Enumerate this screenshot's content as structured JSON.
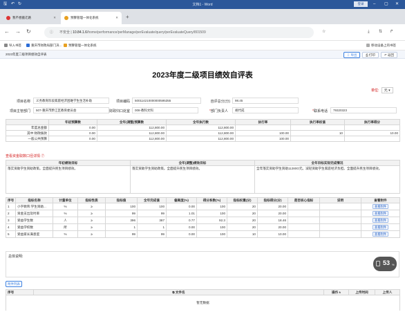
{
  "word": {
    "title": "文档1 - Word",
    "login": "登录"
  },
  "tabs": [
    {
      "label": "我不想搬迁路"
    },
    {
      "label": "预算管理一体化系统"
    }
  ],
  "address": {
    "secure": "不安全",
    "host": "10.84.1.6",
    "path": "/home/performance/perManage/perEvaluate/query/perEvaluateQuery/801509"
  },
  "bookmarks": {
    "import": "导入书签",
    "b1": "重庆市财政局部门决...",
    "b2": "预算管理一体化系统",
    "mobile": "移动设备上的书签"
  },
  "breadcrumb": "2023年度二级项目绩效自评表",
  "toolbar": {
    "export": "导出",
    "print": "打印",
    "back": "返回"
  },
  "doc": {
    "title": "2023年度二级项目绩效自评表",
    "unit_label": "单位:",
    "unit_value": "元"
  },
  "info": {
    "proj_name_label": "项目名称",
    "proj_name": "义务教育阶段家庭经济困难学生生活补助",
    "proj_code_label": "项目编码",
    "proj_code": "500114210000000595355",
    "score_label": "自评总分(分)",
    "score": "98.45",
    "dept_label": "项目主管部门",
    "dept": "507-重庆市黔江区教育委员会",
    "office_label": "财政归口处室",
    "office": "008-教科文科",
    "leader_label": "部门负责人",
    "leader": "胡代成",
    "phone_label": "联系电话",
    "phone": "79320323"
  },
  "funds": {
    "headers": [
      "",
      "年初预算数",
      "全年(调整)预算数",
      "全年执行数",
      "执行率",
      "执行率权值",
      "执行率得分"
    ],
    "rows": [
      [
        "年度总金额",
        "0.00",
        "112,800.00",
        "112,800.00",
        "",
        "",
        ""
      ],
      [
        "其中:财政拨款",
        "0.00",
        "112,800.00",
        "112,800.00",
        "100.00",
        "10",
        "10.00"
      ],
      [
        "一般公共预算",
        "0.00",
        "112,800.00",
        "112,800.00",
        "100.00",
        "",
        ""
      ]
    ]
  },
  "detail_link": "查看资金取数口径详情 ⑦",
  "goals": {
    "headers": [
      "年初绩效目标",
      "全年(调整)绩效目标",
      "全年目标实际完成情况"
    ],
    "row": [
      "落实资助学生资助政策。全面提升民生项目绩效。",
      "落实资助学生资助政策。全面提升民生项目绩效。",
      "全年落实资助学生资助11280O元。减轻资助学生家庭经济负担。全面提升民生项目绩效。"
    ]
  },
  "indicators": {
    "headers": [
      "序号",
      "指标名称",
      "计量单位",
      "指标性质",
      "指标值",
      "全年完成值",
      "偏离度(%)",
      "得分系数(%)",
      "指标权重(分)",
      "指标得分(分)",
      "是否核心指标",
      "说明",
      "查看附件"
    ],
    "rows": [
      [
        "1",
        "小学教育:学生资助...",
        "%",
        "≥",
        "100",
        "100",
        "0.00",
        "100",
        "20",
        "20.00",
        "",
        "",
        "查看附件"
      ],
      [
        "2",
        "资金支出及时率",
        "%",
        "≥",
        "99",
        "99",
        "1.01",
        "100",
        "20",
        "20.00",
        "",
        "",
        "查看附件"
      ],
      [
        "3",
        "受益学生数",
        "人",
        "≥",
        "396",
        "387",
        "0.77",
        "92.3",
        "20",
        "18.46",
        "",
        "",
        "查看附件"
      ],
      [
        "4",
        "受益学校数",
        "所",
        "≥",
        "1",
        "1",
        "0.00",
        "100",
        "20",
        "20.00",
        "",
        "",
        "查看附件"
      ],
      [
        "5",
        "受益家长满意度",
        "%",
        "≥",
        "99",
        "99",
        "0.00",
        "100",
        "10",
        "10.00",
        "",
        "",
        "查看附件"
      ]
    ]
  },
  "summary_label": "总体说明:",
  "float": {
    "value": "53",
    "unit": "%"
  },
  "attach": {
    "button": "附件列表",
    "headers": [
      "序号",
      "文件名",
      "操作 ±",
      "上传时间",
      "上传人"
    ],
    "empty": "暂无数据"
  }
}
